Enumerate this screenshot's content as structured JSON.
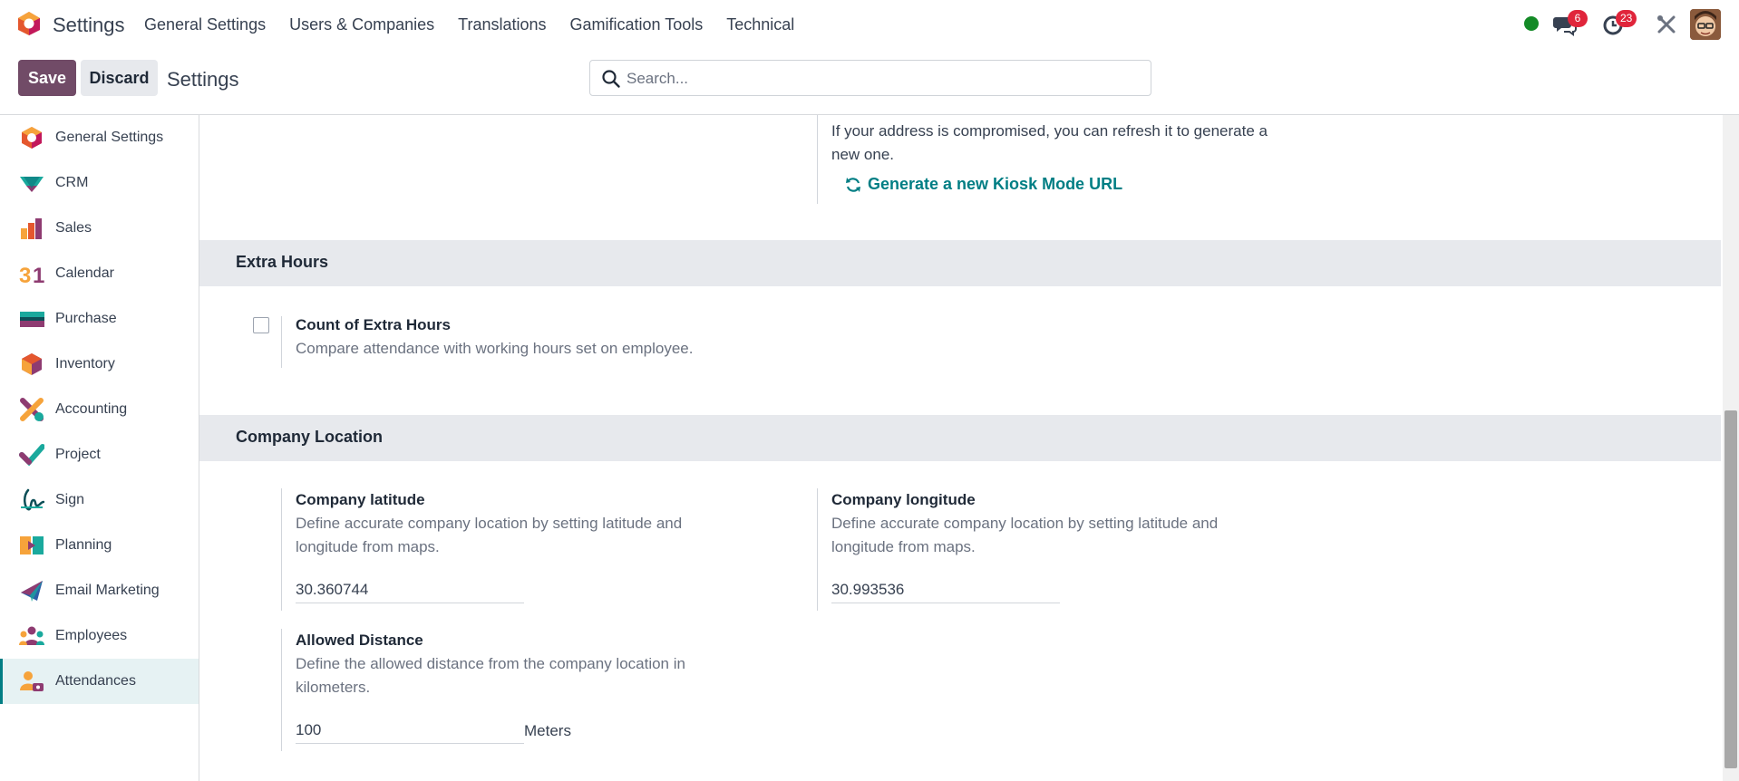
{
  "topbar": {
    "app_title": "Settings",
    "menu": [
      "General Settings",
      "Users & Companies",
      "Translations",
      "Gamification Tools",
      "Technical"
    ],
    "messages_badge": "6",
    "activities_badge": "23",
    "presence_color": "#138a26"
  },
  "control": {
    "save_label": "Save",
    "discard_label": "Discard",
    "breadcrumb": "Settings",
    "search_placeholder": "Search..."
  },
  "sidebar": {
    "active": "Attendances",
    "items": [
      {
        "label": "General Settings",
        "icon": "general-settings-icon"
      },
      {
        "label": "CRM",
        "icon": "crm-icon"
      },
      {
        "label": "Sales",
        "icon": "sales-icon"
      },
      {
        "label": "Calendar",
        "icon": "calendar-icon"
      },
      {
        "label": "Purchase",
        "icon": "purchase-icon"
      },
      {
        "label": "Inventory",
        "icon": "inventory-icon"
      },
      {
        "label": "Accounting",
        "icon": "accounting-icon"
      },
      {
        "label": "Project",
        "icon": "project-icon"
      },
      {
        "label": "Sign",
        "icon": "sign-icon"
      },
      {
        "label": "Planning",
        "icon": "planning-icon"
      },
      {
        "label": "Email Marketing",
        "icon": "email-marketing-icon"
      },
      {
        "label": "Employees",
        "icon": "employees-icon"
      },
      {
        "label": "Attendances",
        "icon": "attendances-icon"
      }
    ]
  },
  "kiosk": {
    "desc_line1": "If your address is compromised, you can refresh it to generate a",
    "desc_line2": "new one.",
    "link_label": "Generate a new Kiosk Mode URL"
  },
  "extra_hours": {
    "section_title": "Extra Hours",
    "title": "Count of Extra Hours",
    "desc": "Compare attendance with working hours set on employee.",
    "checked": false
  },
  "company_location": {
    "section_title": "Company Location",
    "latitude": {
      "title": "Company latitude",
      "desc_line1": "Define accurate company location by setting latitude and",
      "desc_line2": "longitude from maps.",
      "value": "30.360744"
    },
    "longitude": {
      "title": "Company longitude",
      "desc_line1": "Define accurate company location by setting latitude and",
      "desc_line2": "longitude from maps.",
      "value": "30.993536"
    },
    "distance": {
      "title": "Allowed Distance",
      "desc_line1": "Define the allowed distance from the company location in",
      "desc_line2": "kilometers.",
      "value": "100",
      "unit": "Meters"
    }
  },
  "colors": {
    "brand": "#714b67",
    "accent": "#017e84",
    "badge": "#e0253b"
  }
}
